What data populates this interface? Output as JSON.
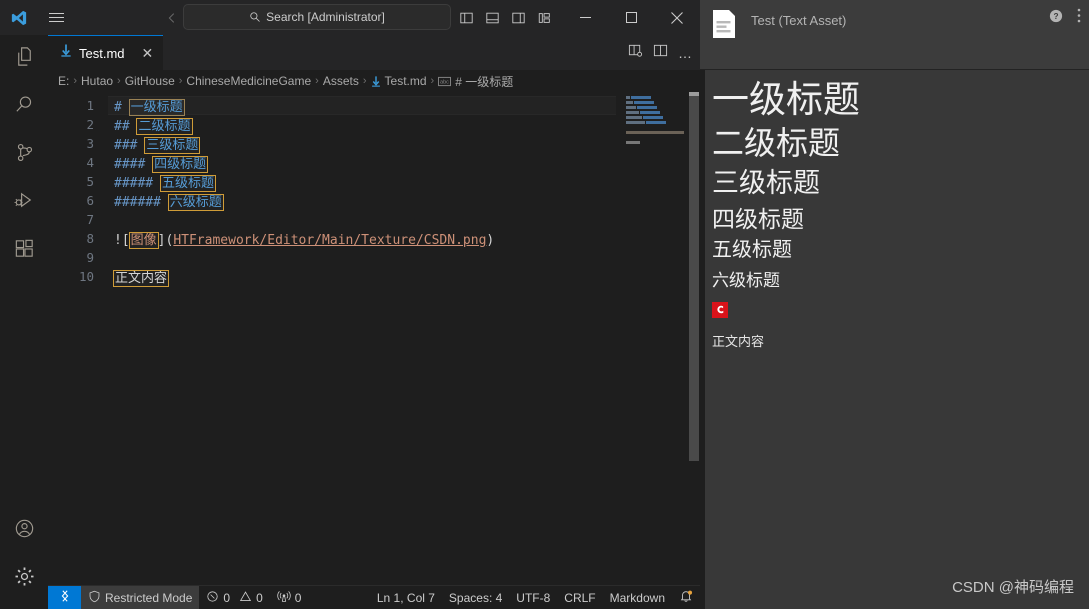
{
  "titlebar": {
    "logo_icon": "vscode-logo-icon",
    "menu_icon": "hamburger-menu-icon",
    "back_icon": "arrow-left-icon",
    "forward_icon": "arrow-right-icon",
    "search_placeholder": "Search [Administrator]",
    "search_icon": "search-icon",
    "layout_icons": [
      "toggle-primary-sidebar-icon",
      "toggle-panel-icon",
      "toggle-secondary-sidebar-icon",
      "customize-layout-icon"
    ],
    "minimize_label": "–",
    "maximize_label": "□",
    "close_label": "✕"
  },
  "activitybar": {
    "items": [
      {
        "name": "explorer",
        "icon": "files-icon"
      },
      {
        "name": "search",
        "icon": "search-icon"
      },
      {
        "name": "source-control",
        "icon": "source-control-icon"
      },
      {
        "name": "run-debug",
        "icon": "run-and-debug-icon"
      },
      {
        "name": "extensions",
        "icon": "extensions-icon"
      }
    ],
    "bottom": [
      {
        "name": "accounts",
        "icon": "account-icon"
      },
      {
        "name": "manage",
        "icon": "gear-icon"
      }
    ]
  },
  "tabs": {
    "active": {
      "label": "Test.md",
      "icon": "markdown-file-icon",
      "close_label": "✕"
    },
    "actions": [
      "open-preview-to-side-icon",
      "split-editor-right-icon",
      "more-actions-icon"
    ],
    "more_label": "…"
  },
  "breadcrumbs": {
    "separator": "›",
    "items": [
      "E:",
      "Hutao",
      "GitHouse",
      "ChineseMedicineGame",
      "Assets",
      "Test.md",
      "# 一级标题"
    ],
    "file_icon": "markdown-file-icon",
    "symbol_icon": "symbol-string-icon"
  },
  "editor": {
    "lines": [
      {
        "num": "1",
        "current": true,
        "type": "heading",
        "marks": "#",
        "text": "一级标题",
        "box": "gray"
      },
      {
        "num": "2",
        "current": false,
        "type": "heading",
        "marks": "##",
        "text": "二级标题",
        "box": "orange"
      },
      {
        "num": "3",
        "current": false,
        "type": "heading",
        "marks": "###",
        "text": "三级标题",
        "box": "orange"
      },
      {
        "num": "4",
        "current": false,
        "type": "heading",
        "marks": "####",
        "text": "四级标题",
        "box": "orange"
      },
      {
        "num": "5",
        "current": false,
        "type": "heading",
        "marks": "#####",
        "text": "五级标题",
        "box": "orange"
      },
      {
        "num": "6",
        "current": false,
        "type": "heading",
        "marks": "######",
        "text": "六级标题",
        "box": "orange"
      },
      {
        "num": "7",
        "current": false,
        "type": "empty",
        "marks": "",
        "text": ""
      },
      {
        "num": "8",
        "current": false,
        "type": "image",
        "alt": "图像",
        "path": "HTFramework/Editor/Main/Texture/CSDN.png"
      },
      {
        "num": "9",
        "current": false,
        "type": "empty",
        "marks": "",
        "text": ""
      },
      {
        "num": "10",
        "current": false,
        "type": "text",
        "marks": "",
        "text": "正文内容",
        "box": "orange"
      }
    ],
    "image_prefix": "![",
    "image_mid": "](",
    "image_suffix": ")"
  },
  "statusbar": {
    "remote_icon": "remote-window-icon",
    "restricted_mode": "Restricted Mode",
    "shield_icon": "shield-icon",
    "errors": "0",
    "warnings": "0",
    "ports": "0",
    "error_icon": "error-circle-icon",
    "warning_icon": "warning-triangle-icon",
    "ports_icon": "radio-tower-icon",
    "cursor_position": "Ln 1, Col 7",
    "indentation": "Spaces: 4",
    "encoding": "UTF-8",
    "eol": "CRLF",
    "language": "Markdown",
    "bell_icon": "notification-bell-icon"
  },
  "inspector": {
    "title": "Test (Text Asset)",
    "doc_icon": "text-asset-document-icon",
    "help_icon": "help-circle-icon",
    "menu_icon": "kebab-menu-icon",
    "preview": {
      "h1": "一级标题",
      "h2": "二级标题",
      "h3": "三级标题",
      "h4": "四级标题",
      "h5": "五级标题",
      "h6": "六级标题",
      "image_alt": "图像",
      "image_icon": "csdn-logo-icon",
      "body": "正文内容"
    },
    "watermark": "CSDN @神码编程"
  },
  "colors": {
    "accent": "#0078d4",
    "heading_blue": "#569cd6",
    "box_orange": "#cf9c38",
    "link_orange": "#ce9178",
    "csdn_red": "#d9131a",
    "editor_bg": "#1e1e1e",
    "unity_bg": "#383838"
  }
}
